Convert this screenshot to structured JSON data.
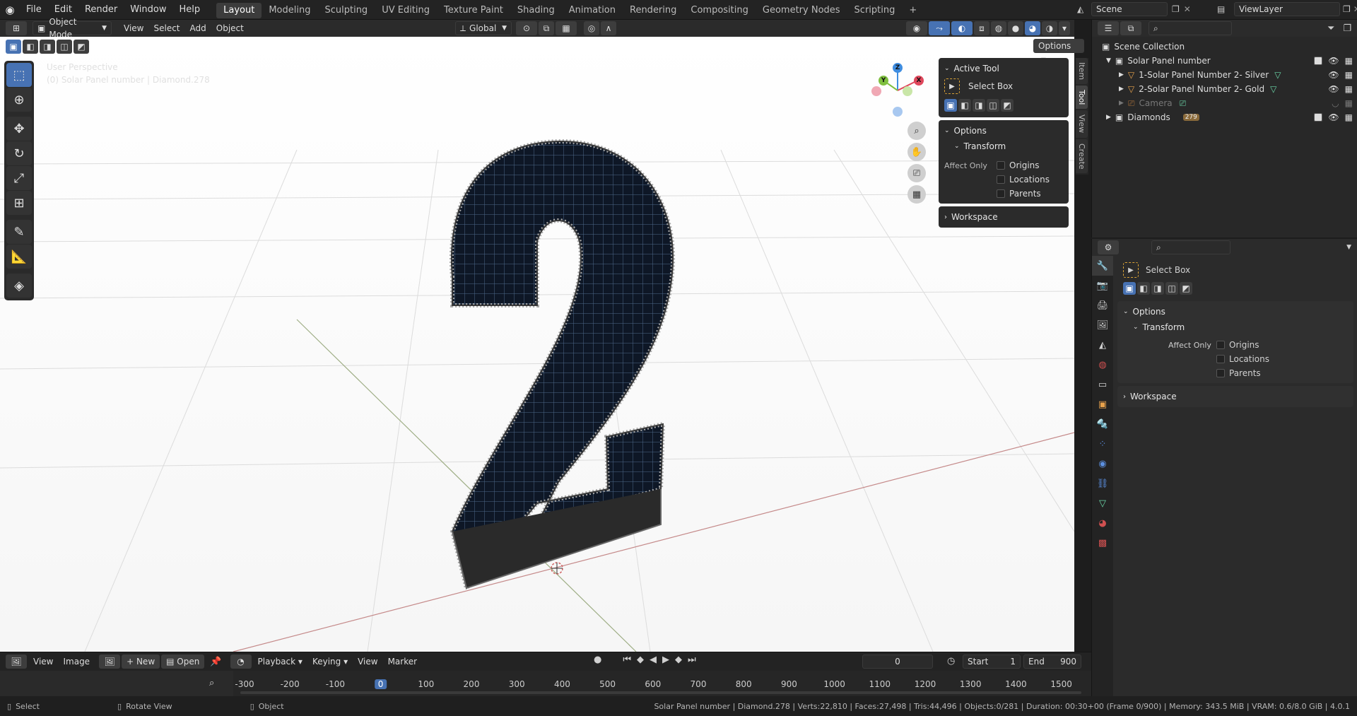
{
  "topmenu": [
    "File",
    "Edit",
    "Render",
    "Window",
    "Help"
  ],
  "workspaces": [
    "Layout",
    "Modeling",
    "Sculpting",
    "UV Editing",
    "Texture Paint",
    "Shading",
    "Animation",
    "Rendering",
    "Compositing",
    "Geometry Nodes",
    "Scripting"
  ],
  "workspace_add": "+",
  "scene": {
    "label": "Scene",
    "viewlayer": "ViewLayer"
  },
  "vphead": {
    "mode": "Object Mode",
    "menus": [
      "View",
      "Select",
      "Add",
      "Object"
    ],
    "orientation": "Global",
    "options": "Options"
  },
  "viewport": {
    "perspective": "User Perspective",
    "info": "(0) Solar Panel number | Diamond.278"
  },
  "gizmo": {
    "z": "Z",
    "y": "Y",
    "x": "X"
  },
  "npanel": {
    "tabs": [
      "Item",
      "Tool",
      "View",
      "Create"
    ],
    "active_tool": "Active Tool",
    "tool_name": "Select Box",
    "options": "Options",
    "transform": "Transform",
    "affect_only": "Affect Only",
    "checks": [
      "Origins",
      "Locations",
      "Parents"
    ],
    "workspace": "Workspace"
  },
  "outliner": {
    "root": "Scene Collection",
    "items": [
      {
        "name": "Solar Panel number",
        "level": 1
      },
      {
        "name": "1-Solar Panel  Number 2- Silver",
        "level": 2
      },
      {
        "name": "2-Solar Panel  Number 2- Gold",
        "level": 2
      },
      {
        "name": "Camera",
        "level": 2
      },
      {
        "name": "Diamonds",
        "level": 1
      }
    ],
    "badge": "279"
  },
  "props": {
    "tool_name": "Select Box",
    "options": "Options",
    "transform": "Transform",
    "affect_only": "Affect Only",
    "checks": [
      "Origins",
      "Locations",
      "Parents"
    ],
    "workspace": "Workspace"
  },
  "timeline": {
    "menus1": [
      "View",
      "Image"
    ],
    "new": "New",
    "open": "Open",
    "menus2": [
      "Playback",
      "Keying",
      "View",
      "Marker"
    ],
    "current_frame": "0",
    "start_label": "Start",
    "start": "1",
    "end_label": "End",
    "end": "900",
    "ticks": [
      "-300",
      "-200",
      "-100",
      "0",
      "100",
      "200",
      "300",
      "400",
      "500",
      "600",
      "700",
      "800",
      "900",
      "1000",
      "1100",
      "1200",
      "1300",
      "1400",
      "1500"
    ]
  },
  "status": {
    "select": "Select",
    "rotate": "Rotate View",
    "object": "Object",
    "stats": "Solar Panel number | Diamond.278 | Verts:22,810 | Faces:27,498 | Tris:44,496 | Objects:0/281 | Duration: 00:30+00 (Frame 0/900) | Memory: 343.5 MiB | VRAM: 0.6/8.0 GiB | 4.0.1"
  },
  "colors": {
    "accent": "#4772b3",
    "axis_x": "#e0485c",
    "axis_y": "#7fbf3f",
    "axis_z": "#3f8de0"
  }
}
